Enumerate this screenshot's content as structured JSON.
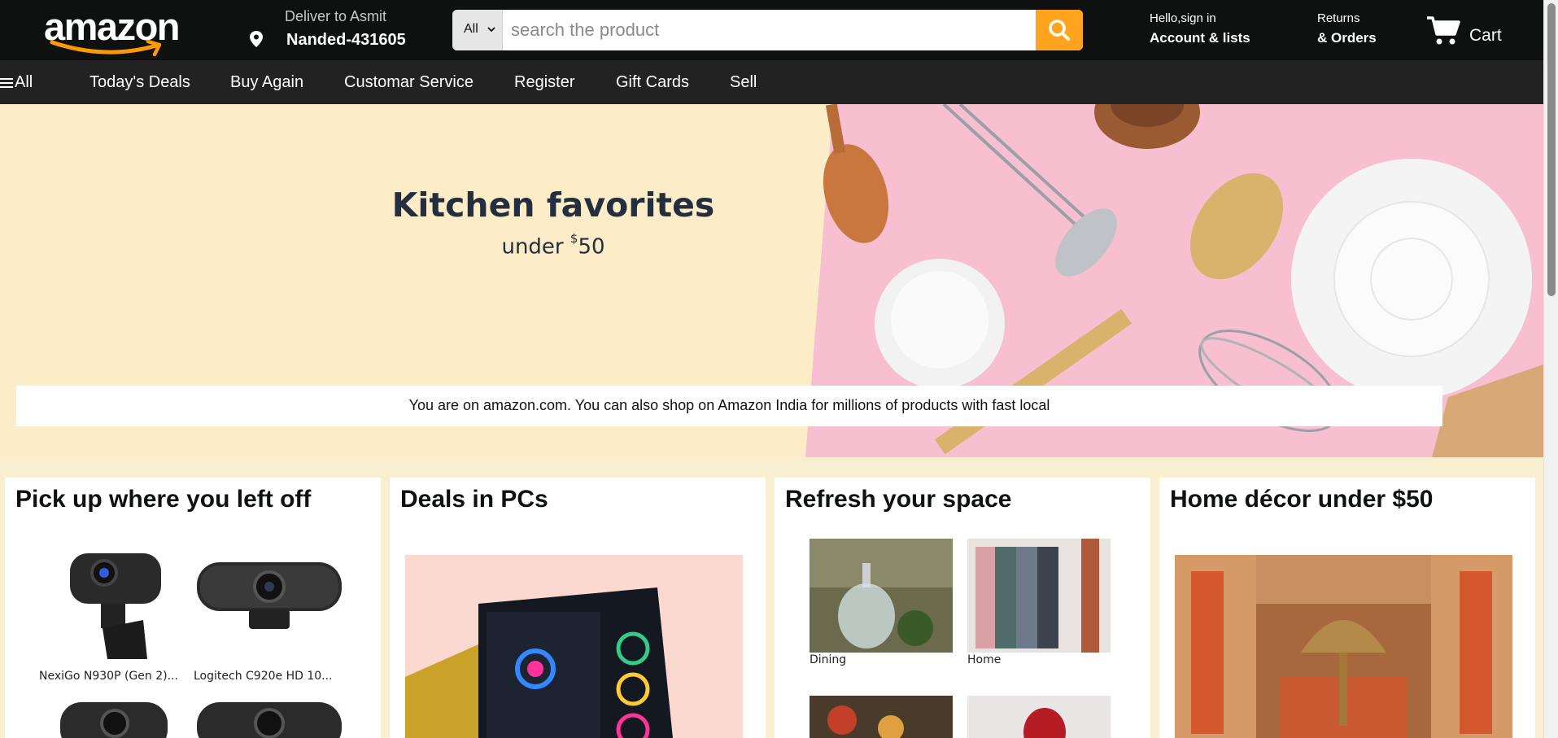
{
  "header": {
    "logo_text": "amazon",
    "deliver_to": "Deliver to Asmit",
    "location": "Nanded-431605",
    "search": {
      "category": "All",
      "placeholder": "search the product"
    },
    "account_line1": "Hello,sign in",
    "account_line2": "Account & lists",
    "returns_line1": "Returns",
    "returns_line2": "& Orders",
    "cart_label": "Cart"
  },
  "subnav": {
    "all_label": "All",
    "items": [
      "Today's Deals",
      "Buy Again",
      "Customar Service",
      "Register",
      "Gift Cards",
      "Sell"
    ]
  },
  "hero": {
    "title": "Kitchen favorites",
    "subtitle_prefix": "under ",
    "subtitle_currency": "$",
    "subtitle_amount": "50",
    "notice": "You are on amazon.com. You can also shop on Amazon India for millions of products with fast local"
  },
  "cards": [
    {
      "title": "Pick up where you left off",
      "items": [
        {
          "caption": "NexiGo N930P (Gen 2)..."
        },
        {
          "caption": "Logitech C920e HD 10..."
        }
      ]
    },
    {
      "title": "Deals in PCs"
    },
    {
      "title": "Refresh your space",
      "items": [
        {
          "caption": "Dining"
        },
        {
          "caption": "Home"
        }
      ]
    },
    {
      "title": "Home décor under $50"
    }
  ],
  "colors": {
    "header_bg": "#0f1111",
    "subnav_bg": "#222222",
    "search_button": "#ffa41c",
    "hero_bg": "#fdecc8",
    "hero_pink": "#f7bfd0",
    "page_bg": "#f7efd0"
  },
  "icons": {
    "location": "map-pin-icon",
    "search": "search-icon",
    "cart": "cart-icon",
    "menu": "hamburger-icon"
  }
}
